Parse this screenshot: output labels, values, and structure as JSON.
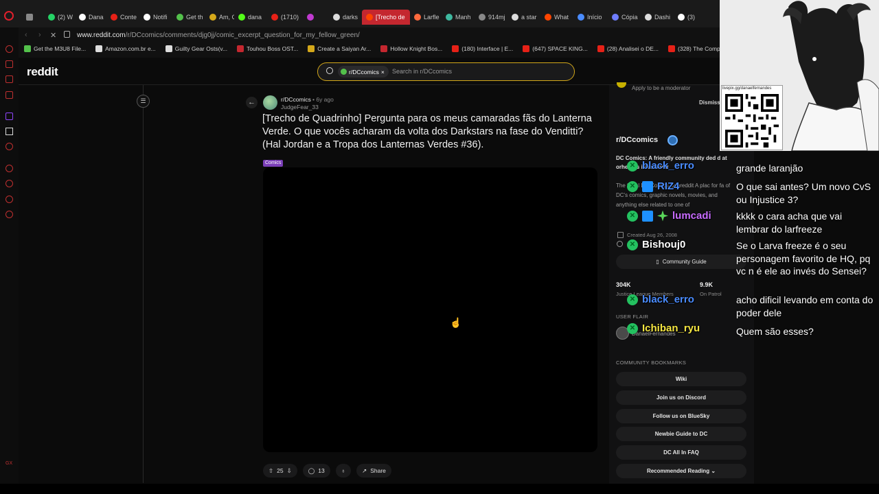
{
  "browser": {
    "tabs": [
      {
        "label": "",
        "color": "#888888",
        "icon": "window-icon"
      },
      {
        "label": "(2) W",
        "color": "#25d366",
        "icon": "whatsapp-icon"
      },
      {
        "label": "Dana",
        "color": "#ffffff",
        "icon": "x-icon"
      },
      {
        "label": "Conte",
        "color": "#e62117",
        "icon": "youtube-icon"
      },
      {
        "label": "Notifi",
        "color": "#ffffff",
        "icon": "x-icon"
      },
      {
        "label": "Get th",
        "color": "#53c14b",
        "icon": "site-icon"
      },
      {
        "label": "Am, G",
        "color": "#d4a81a",
        "icon": "site-icon"
      },
      {
        "label": "dana",
        "color": "#53fc18",
        "icon": "kick-icon"
      },
      {
        "label": "(1710)",
        "color": "#e62117",
        "icon": "youtube-icon"
      },
      {
        "label": "",
        "color": "#c03ad0",
        "icon": "sound-icon"
      },
      {
        "label": "darks",
        "color": "#dddddd",
        "icon": "google-icon"
      },
      {
        "label": "[Trecho de",
        "color": "#ff4500",
        "icon": "reddit-icon",
        "active": true
      },
      {
        "label": "Larfle",
        "color": "#ff6a3d",
        "icon": "site-icon"
      },
      {
        "label": "Manh",
        "color": "#3fb9a0",
        "icon": "site-icon"
      },
      {
        "label": "914mj",
        "color": "#888888",
        "icon": "site-icon"
      },
      {
        "label": "a star",
        "color": "#dddddd",
        "icon": "google-icon"
      },
      {
        "label": "What",
        "color": "#ff4500",
        "icon": "reddit-icon"
      },
      {
        "label": "Início",
        "color": "#4a8cff",
        "icon": "site-icon"
      },
      {
        "label": "Cópia",
        "color": "#6f7dff",
        "icon": "site-icon"
      },
      {
        "label": "Dashi",
        "color": "#dddddd",
        "icon": "site-icon"
      },
      {
        "label": "(3)",
        "color": "#ffffff",
        "icon": "x-icon"
      }
    ],
    "url_host": "www.reddit.com",
    "url_path": "/r/DCcomics/comments/djg0jj/comic_excerpt_question_for_my_fellow_green/",
    "bookmarks": [
      {
        "label": "Get the M3U8 File...",
        "color": "#53c14b"
      },
      {
        "label": "Amazon.com.br e...",
        "color": "#dddddd"
      },
      {
        "label": "Guilty Gear Osts(v...",
        "color": "#dddddd"
      },
      {
        "label": "Touhou Boss OST...",
        "color": "#c4272f"
      },
      {
        "label": "Create a Saiyan Ar...",
        "color": "#d4a81a"
      },
      {
        "label": "Hollow Knight Bos...",
        "color": "#c4272f"
      },
      {
        "label": "(180) Interface | E...",
        "color": "#e62117"
      },
      {
        "label": "(647) SPACE KING...",
        "color": "#e62117"
      },
      {
        "label": "(28) Analisei o DE...",
        "color": "#e62117"
      },
      {
        "label": "(328) The Comple...",
        "color": "#e62117"
      }
    ]
  },
  "reddit": {
    "logo": "reddit",
    "search_chip": "r/DCcomics",
    "search_placeholder": "Search in r/DCcomics",
    "post": {
      "subreddit": "r/DCcomics",
      "age": "• 6y ago",
      "author": "JudgeFear_33",
      "title": "[Trecho de Quadrinho] Pergunta para os meus camaradas fãs do Lanterna Verde. O que vocês acharam da volta dos Darkstars na fase do Venditti? (Hal Jordan e a Tropa dos Lanternas Verdes #36).",
      "flair": "Comics",
      "votes": "25",
      "comments": "13",
      "share": "Share"
    },
    "sidebar": {
      "mod_link": "Apply to be a moderator",
      "dismiss": "Dismiss",
      "community_name": "r/DCcomics",
      "desc_title": "DC Comics: A friendly community ded    d     at     orheroes i the world",
      "desc": "The      fficial DC Comics Subreddit A plac for fa   of DC's comics, graphic novels, movies, and anything else related to one of",
      "created": "Created Aug 26, 2008",
      "guide_button": "Community Guide",
      "stats": [
        {
          "num": "304K",
          "label": "Justice League Members"
        },
        {
          "num": "9.9K",
          "label": "On Patrol"
        }
      ],
      "user_flair_heading": "USER FLAIR",
      "flair_user": "DanaelFernandes",
      "bookmarks_heading": "COMMUNITY BOOKMARKS",
      "bookmark_buttons": [
        "Wiki",
        "Join us on Discord",
        "Follow us on BlueSky",
        "Newbie Guide to DC",
        "DC All In FAQ",
        "Recommended Reading"
      ]
    }
  },
  "overlay": {
    "qr_label": "livepix.gg/danaelfernandes",
    "chat": [
      {
        "name": "black_erro",
        "color": "#4a8cff",
        "message": "grande laranjão"
      },
      {
        "name": "RIZ4",
        "color": "#4a8cff",
        "message": "O que sai antes? Um novo CvS ou Injustice 3?"
      },
      {
        "name": "lumcadi",
        "color": "#c86cff",
        "message": "kkkk o cara acha que vai lembrar do larfreeze"
      },
      {
        "name": "Bishouj0",
        "color": "#ffffff",
        "message": "Se o Larva freeze é o seu personagem favorito de HQ, pq vc n é ele ao invés do Sensei?"
      },
      {
        "name": "black_erro",
        "color": "#4a8cff",
        "message": "acho dificil levando em conta do poder dele"
      },
      {
        "name": "Ichiban_ryu",
        "color": "#f5e642",
        "message": "Quem são esses?"
      }
    ],
    "corner_label": "GX"
  }
}
